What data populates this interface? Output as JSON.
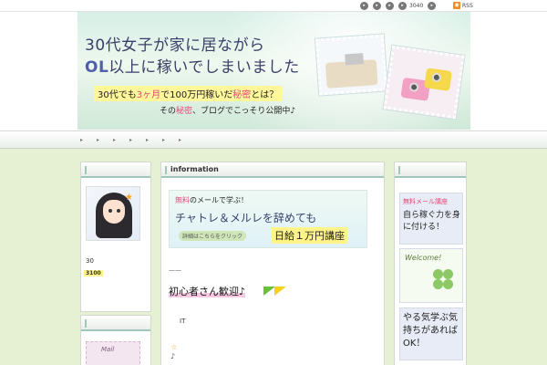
{
  "topbar": {
    "count": "3040",
    "rss_label": "RSS"
  },
  "banner": {
    "line1": "30代女子が家に居ながら",
    "line2_prefix": "OL",
    "line2_rest": "以上に稼いでしまいました",
    "line3_a": "30代でも",
    "line3_b": "3ヶ月",
    "line3_c": "で100万円稼いだ",
    "line3_d": "秘密",
    "line3_e": "とは？",
    "line4_a": "その",
    "line4_b": "秘密",
    "line4_c": "、ブログでこっそり公開中♪"
  },
  "nav": {
    "items": [
      "▸",
      "▸",
      "▸",
      "▸",
      "▸",
      "▸",
      "▸"
    ]
  },
  "left": {
    "profile_num": "30",
    "profile_highlight": "3100",
    "mail_label": "Mail"
  },
  "main": {
    "title": "information",
    "promo_a1": "無料",
    "promo_a2": "のメールで学ぶ！",
    "promo_b": "チャトレ＆メルレを辞めても",
    "promo_c": "詳細はこちらをクリック",
    "promo_d": "日給１万円講座",
    "dash": "——",
    "welcome": "初心者さん歓迎♪",
    "it": "IT",
    "star": "☆",
    "note": "♪"
  },
  "right": {
    "card1_a": "無料メール講座",
    "card1_b": "自ら稼ぐ力を身に付ける！",
    "card2_a": "Welcome!",
    "card3": "やる気学ぶ気持ちがあればOK！"
  }
}
